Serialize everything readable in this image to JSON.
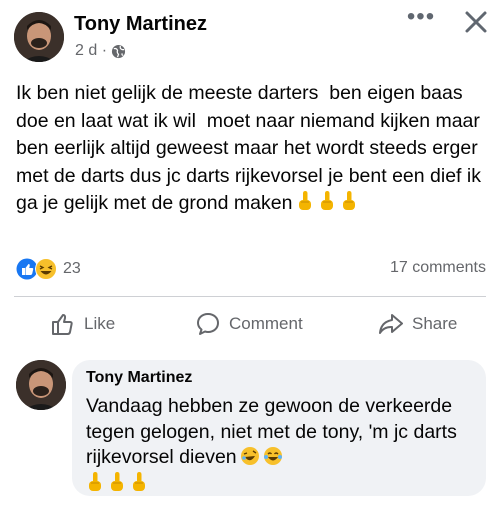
{
  "post": {
    "author": "Tony Martinez",
    "timestamp": "2 d ·",
    "privacy_icon": "globe-icon",
    "text": "Ik ben niet gelijk de meeste darters  ben eigen baas doe en laat wat ik wil  moet naar niemand kijken maar ben eerlijk altijd geweest maar het wordt steeds erger met de darts dus jc darts rijkevorsel je bent een dief ik ga je gelijk met de grond maken",
    "trailing_emojis": [
      "middle-finger-emoji",
      "middle-finger-emoji",
      "middle-finger-emoji"
    ],
    "more_icon": "more-horizontal-icon",
    "close_icon": "close-icon"
  },
  "engagement": {
    "reaction_icons": [
      "like-reaction-icon",
      "haha-reaction-icon"
    ],
    "reaction_count": "23",
    "comments_count": "17 comments"
  },
  "actions": {
    "like_label": "Like",
    "comment_label": "Comment",
    "share_label": "Share"
  },
  "comment": {
    "author": "Tony Martinez",
    "text": "Vandaag hebben ze gewoon de verkeerde tegen gelogen, niet met de tony, 'm jc darts rijkevorsel dieven",
    "inline_emojis": [
      "rolling-laughing-emoji",
      "tears-of-joy-emoji"
    ],
    "trailing_emojis": [
      "middle-finger-emoji",
      "middle-finger-emoji",
      "middle-finger-emoji"
    ]
  },
  "colors": {
    "like_blue": "#1877f2",
    "secondary_text": "#65676b",
    "bubble_bg": "#f0f2f5",
    "emoji_yellow": "#f7c02b"
  }
}
